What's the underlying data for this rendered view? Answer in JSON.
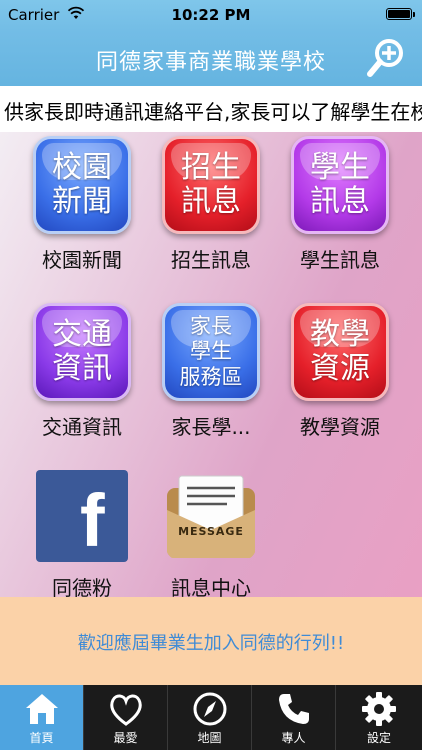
{
  "status_bar": {
    "carrier": "Carrier",
    "time": "10:22 PM"
  },
  "header": {
    "title": "同德家事商業職業學校"
  },
  "marquee": {
    "text": "供家長即時通訊連絡平台,家長可以了解學生在校"
  },
  "tiles": [
    {
      "icon_text": "校園\n新聞",
      "label": "校園新聞",
      "color": "#3a6fe8"
    },
    {
      "icon_text": "招生\n訊息",
      "label": "招生訊息",
      "color": "#e5202a"
    },
    {
      "icon_text": "學生\n訊息",
      "label": "學生訊息",
      "color": "#b33ae8"
    },
    {
      "icon_text": "交通\n資訊",
      "label": "交通資訊",
      "color": "#8a3ae8"
    },
    {
      "icon_text": "家長\n學生\n服務區",
      "label": "家長學...",
      "color": "#3a6fe8"
    },
    {
      "icon_text": "教學\n資源",
      "label": "教學資源",
      "color": "#e5202a"
    },
    {
      "icon_text": "f",
      "label": "同德粉",
      "color": "#3b5998"
    },
    {
      "icon_text": "MESSAGE",
      "label": "訊息中心",
      "color": "#c9a06a"
    }
  ],
  "banner": {
    "text": "歡迎應屆畢業生加入同德的行列!!"
  },
  "tabbar": {
    "items": [
      {
        "label": "首頁",
        "icon": "home-icon",
        "active": true
      },
      {
        "label": "最愛",
        "icon": "heart-icon",
        "active": false
      },
      {
        "label": "地圖",
        "icon": "compass-icon",
        "active": false
      },
      {
        "label": "專人",
        "icon": "phone-icon",
        "active": false
      },
      {
        "label": "設定",
        "icon": "gear-icon",
        "active": false
      }
    ],
    "active_color": "#4ea4e0"
  }
}
